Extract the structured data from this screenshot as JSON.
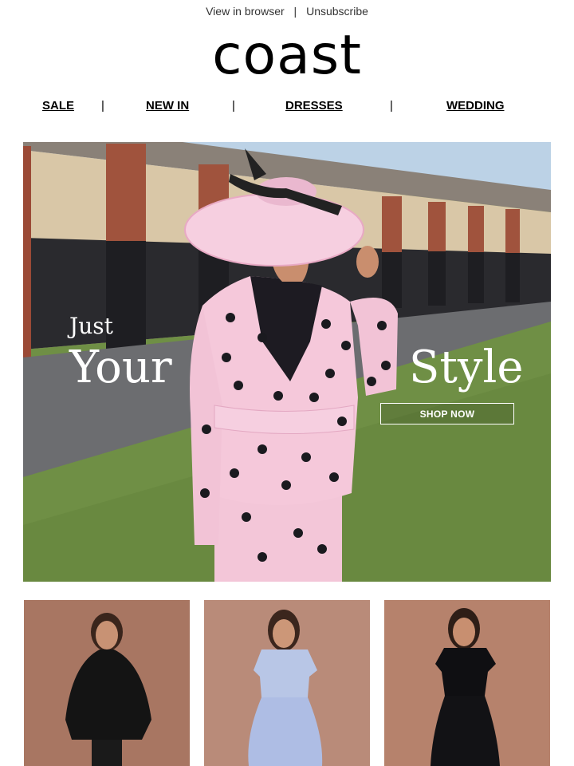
{
  "header": {
    "view_in_browser": "View in browser",
    "separator": "|",
    "unsubscribe": "Unsubscribe",
    "logo": "coast"
  },
  "nav": {
    "items": [
      {
        "label": "SALE"
      },
      {
        "label": "NEW IN"
      },
      {
        "label": "DRESSES"
      },
      {
        "label": "WEDDING"
      }
    ],
    "divider": "|"
  },
  "hero": {
    "line1": "Just",
    "line2": "Your",
    "line3": "Style",
    "cta": "SHOP NOW"
  },
  "products": [
    {
      "name": "black-cape-coat-photo"
    },
    {
      "name": "lilac-two-piece-photo"
    },
    {
      "name": "black-velvet-dress-photo"
    }
  ],
  "colors": {
    "text": "#111111",
    "hero_grass": "#6f8f45",
    "tile_bg": "#b9836e"
  }
}
